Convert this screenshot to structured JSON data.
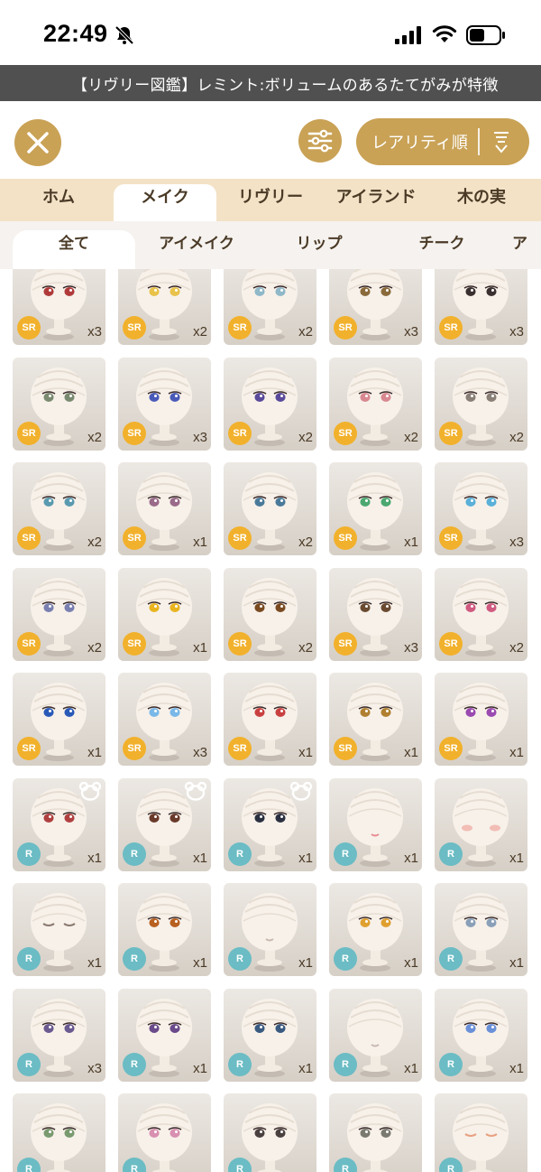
{
  "status": {
    "time": "22:49",
    "icons": [
      "bell-slash-icon",
      "signal-icon",
      "wifi-icon",
      "battery-icon"
    ]
  },
  "ticker": {
    "text": "【リヴリー図鑑】レミント:ボリュームのあるたてがみが特徴"
  },
  "toolbar": {
    "close_icon": "close-icon",
    "filter_icon": "sliders-icon",
    "sort_label": "レアリティ順",
    "sort_icon": "sort-descending-icon"
  },
  "category_tabs": [
    {
      "label": "ホム",
      "active": false
    },
    {
      "label": "メイク",
      "active": true
    },
    {
      "label": "リヴリー",
      "active": false
    },
    {
      "label": "アイランド",
      "active": false
    },
    {
      "label": "木の実",
      "active": false
    }
  ],
  "sub_tabs": [
    {
      "label": "全て",
      "active": true
    },
    {
      "label": "アイメイク",
      "active": false
    },
    {
      "label": "リップ",
      "active": false
    },
    {
      "label": "チーク",
      "active": false
    },
    {
      "label": "ア",
      "active": false
    }
  ],
  "colors": {
    "accent_gold": "#c9a256",
    "tab_bar": "#f3e2c6",
    "sr_badge": "#f2b12c",
    "r_badge": "#6bbcc4",
    "ticker_bg": "#505050"
  },
  "items": [
    {
      "rarity": "SR",
      "qty": "x3",
      "eye": "#b03a3a",
      "style": "eyes"
    },
    {
      "rarity": "SR",
      "qty": "x2",
      "eye": "#e8c24a",
      "style": "eyes"
    },
    {
      "rarity": "SR",
      "qty": "x2",
      "eye": "#8fb8c8",
      "style": "eyes"
    },
    {
      "rarity": "SR",
      "qty": "x3",
      "eye": "#8a6a3a",
      "style": "eyes"
    },
    {
      "rarity": "SR",
      "qty": "x3",
      "eye": "#3a3030",
      "style": "eyes"
    },
    {
      "rarity": "SR",
      "qty": "x2",
      "eye": "#7a8a70",
      "style": "eyes"
    },
    {
      "rarity": "SR",
      "qty": "x3",
      "eye": "#4a5ab8",
      "style": "eyes"
    },
    {
      "rarity": "SR",
      "qty": "x2",
      "eye": "#5a4a9a",
      "style": "eyes"
    },
    {
      "rarity": "SR",
      "qty": "x2",
      "eye": "#d88890",
      "style": "eyes"
    },
    {
      "rarity": "SR",
      "qty": "x2",
      "eye": "#8a8078",
      "style": "eyes"
    },
    {
      "rarity": "SR",
      "qty": "x2",
      "eye": "#5a9ab0",
      "style": "eyes"
    },
    {
      "rarity": "SR",
      "qty": "x1",
      "eye": "#9a6a8a",
      "style": "eyes"
    },
    {
      "rarity": "SR",
      "qty": "x2",
      "eye": "#4a7a9a",
      "style": "eyes"
    },
    {
      "rarity": "SR",
      "qty": "x1",
      "eye": "#4aa870",
      "style": "eyes"
    },
    {
      "rarity": "SR",
      "qty": "x3",
      "eye": "#5ab0d8",
      "style": "eyes"
    },
    {
      "rarity": "SR",
      "qty": "x2",
      "eye": "#7a80b0",
      "style": "eyes"
    },
    {
      "rarity": "SR",
      "qty": "x1",
      "eye": "#e8b420",
      "style": "eyes"
    },
    {
      "rarity": "SR",
      "qty": "x2",
      "eye": "#7a4a20",
      "style": "eyes"
    },
    {
      "rarity": "SR",
      "qty": "x3",
      "eye": "#6a4a30",
      "style": "eyes"
    },
    {
      "rarity": "SR",
      "qty": "x2",
      "eye": "#d05a80",
      "style": "eyes"
    },
    {
      "rarity": "SR",
      "qty": "x1",
      "eye": "#2a5ab8",
      "style": "eyes"
    },
    {
      "rarity": "SR",
      "qty": "x3",
      "eye": "#7ab8e8",
      "style": "eyes"
    },
    {
      "rarity": "SR",
      "qty": "x1",
      "eye": "#c84040",
      "style": "eyes"
    },
    {
      "rarity": "SR",
      "qty": "x1",
      "eye": "#b08030",
      "style": "eyes"
    },
    {
      "rarity": "SR",
      "qty": "x1",
      "eye": "#9a4ab0",
      "style": "eyes"
    },
    {
      "rarity": "R",
      "qty": "x1",
      "eye": "#b04040",
      "style": "eyes",
      "bear": true
    },
    {
      "rarity": "R",
      "qty": "x1",
      "eye": "#6a3a2a",
      "style": "eyes",
      "bear": true
    },
    {
      "rarity": "R",
      "qty": "x1",
      "eye": "#2a3040",
      "style": "eyes",
      "bear": true
    },
    {
      "rarity": "R",
      "qty": "x1",
      "eye": "#e88a90",
      "style": "lip"
    },
    {
      "rarity": "R",
      "qty": "x1",
      "eye": "#f0b0a8",
      "style": "cheek"
    },
    {
      "rarity": "R",
      "qty": "x1",
      "eye": "#8a7a70",
      "style": "closed"
    },
    {
      "rarity": "R",
      "qty": "x1",
      "eye": "#b86020",
      "style": "eyes"
    },
    {
      "rarity": "R",
      "qty": "x1",
      "eye": "#c8b8b0",
      "style": "lip"
    },
    {
      "rarity": "R",
      "qty": "x1",
      "eye": "#e0a030",
      "style": "eyes"
    },
    {
      "rarity": "R",
      "qty": "x1",
      "eye": "#8aa0b8",
      "style": "eyes"
    },
    {
      "rarity": "R",
      "qty": "x3",
      "eye": "#6a5a90",
      "style": "eyes"
    },
    {
      "rarity": "R",
      "qty": "x1",
      "eye": "#6a4a8a",
      "style": "eyes"
    },
    {
      "rarity": "R",
      "qty": "x1",
      "eye": "#3a5a80",
      "style": "eyes"
    },
    {
      "rarity": "R",
      "qty": "x1",
      "eye": "#c8b8b0",
      "style": "lip"
    },
    {
      "rarity": "R",
      "qty": "x1",
      "eye": "#6a90d8",
      "style": "eyes"
    },
    {
      "rarity": "R",
      "qty": "",
      "eye": "#7a9a70",
      "style": "eyes"
    },
    {
      "rarity": "R",
      "qty": "",
      "eye": "#d890b0",
      "style": "eyes"
    },
    {
      "rarity": "R",
      "qty": "",
      "eye": "#4a4040",
      "style": "eyes"
    },
    {
      "rarity": "R",
      "qty": "",
      "eye": "#7a7a70",
      "style": "eyes"
    },
    {
      "rarity": "R",
      "qty": "",
      "eye": "#e8a080",
      "style": "closed"
    }
  ]
}
